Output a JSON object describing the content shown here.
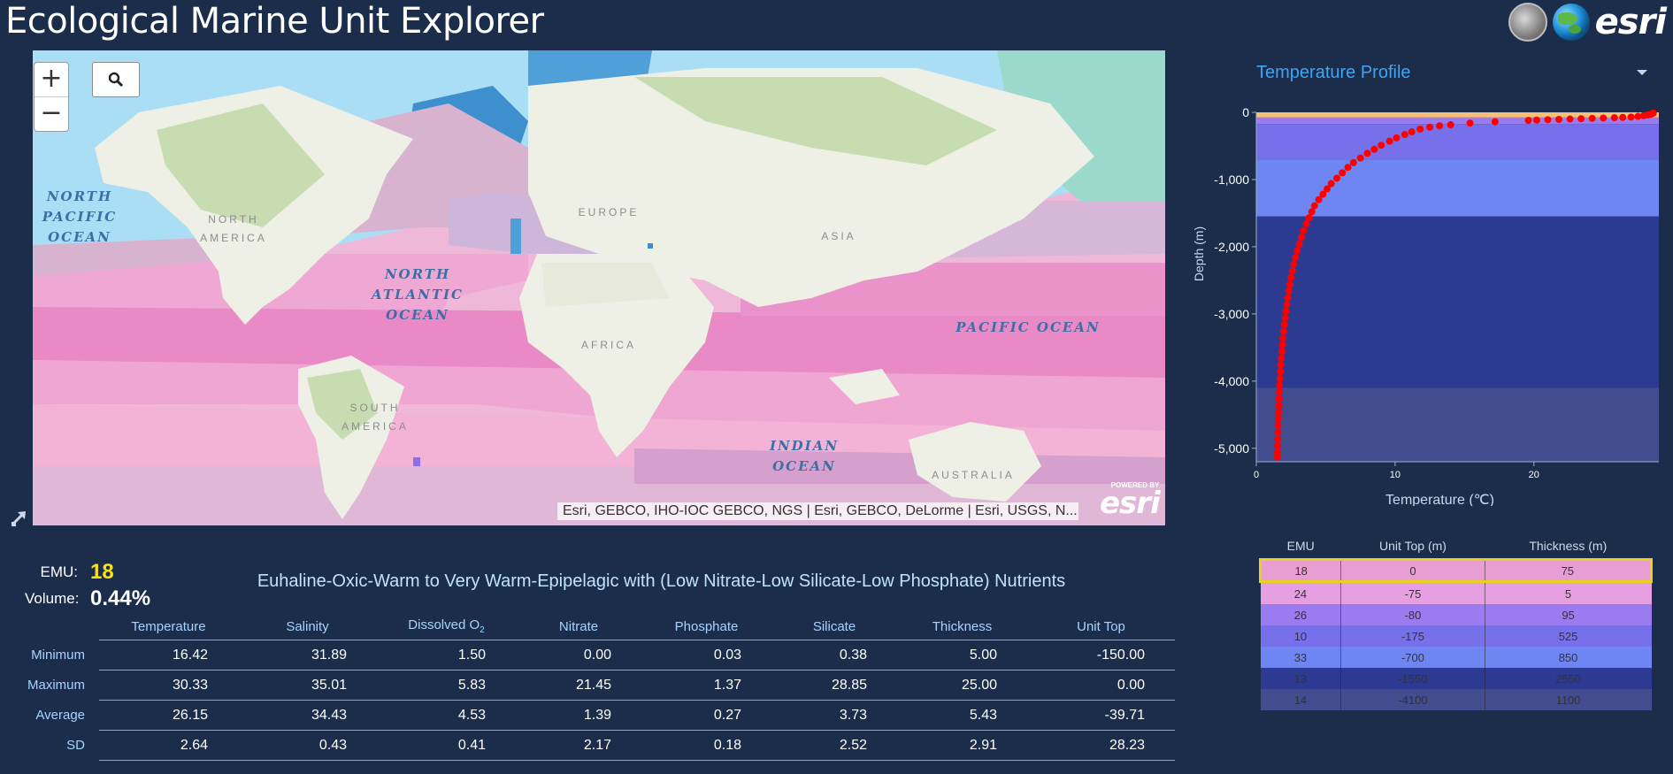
{
  "header": {
    "title": "Ecological Marine Unit Explorer",
    "brand": "esri"
  },
  "map": {
    "zoom_in": "+",
    "zoom_out": "−",
    "attribution": "Esri, GEBCO, IHO-IOC GEBCO, NGS | Esri, GEBCO, DeLorme | Esri, USGS, N...",
    "powered_by": "POWERED BY",
    "esri_logo": "esri",
    "ocean_labels": {
      "north_pacific": [
        "NORTH",
        "PACIFIC",
        "OCEAN"
      ],
      "north_atlantic": [
        "NORTH",
        "ATLANTIC",
        "OCEAN"
      ],
      "pacific": "PACIFIC OCEAN",
      "indian": [
        "INDIAN",
        "OCEAN"
      ]
    },
    "land_labels": {
      "north_america": [
        "NORTH",
        "AMERICA"
      ],
      "europe": "EUROPE",
      "asia": "ASIA",
      "africa": "AFRICA",
      "south_america": [
        "SOUTH",
        "AMERICA"
      ],
      "australia": "AUSTRALIA",
      "south_partial": "SOUTH"
    },
    "colors": {
      "ocean_warm": "#e98ac6",
      "ocean_pink": "#f2b3d6",
      "ocean_mauve": "#d8b3cf",
      "ocean_lavender": "#cdb6da",
      "ocean_light_blue": "#a9def5",
      "ocean_teal": "#9ad9cc",
      "ocean_blue": "#4f9fd8",
      "land": "#eef0e6",
      "land_green": "#c7dcb1"
    }
  },
  "chart_panel": {
    "selector_value": "Temperature Profile",
    "chart_data": {
      "type": "scatter",
      "xlabel": "Temperature (℃)",
      "ylabel": "Depth (m)",
      "xlim": [
        0,
        29
      ],
      "ylim": [
        -5200,
        0
      ],
      "x_ticks": [
        "0",
        "10",
        "20"
      ],
      "x_tick_values": [
        0,
        10,
        20
      ],
      "y_ticks": [
        "0",
        "-1,000",
        "-2,000",
        "-3,000",
        "-4,000",
        "-5,000"
      ],
      "y_tick_values": [
        0,
        -1000,
        -2000,
        -3000,
        -4000,
        -5000
      ],
      "grid": false,
      "point_color": "#ff0000",
      "layers": [
        {
          "top": 0,
          "bottom": -75,
          "color": "#f6c078"
        },
        {
          "top": -75,
          "bottom": -80,
          "color": "#e99ed3"
        },
        {
          "top": -80,
          "bottom": -175,
          "color": "#9a7bf0"
        },
        {
          "top": -175,
          "bottom": -700,
          "color": "#7670ea"
        },
        {
          "top": -700,
          "bottom": -1550,
          "color": "#6f85f2"
        },
        {
          "top": -1550,
          "bottom": -4100,
          "color": "#2c3b91"
        },
        {
          "top": -4100,
          "bottom": -5200,
          "color": "#434c8e"
        }
      ],
      "points": [
        [
          28.6,
          -10
        ],
        [
          28.5,
          -20
        ],
        [
          28.4,
          -30
        ],
        [
          28.2,
          -40
        ],
        [
          27.9,
          -50
        ],
        [
          27.5,
          -60
        ],
        [
          27.0,
          -70
        ],
        [
          26.4,
          -75
        ],
        [
          25.8,
          -80
        ],
        [
          25.0,
          -85
        ],
        [
          24.2,
          -90
        ],
        [
          23.4,
          -95
        ],
        [
          22.6,
          -100
        ],
        [
          21.8,
          -105
        ],
        [
          21.0,
          -110
        ],
        [
          20.2,
          -115
        ],
        [
          19.6,
          -120
        ],
        [
          17.2,
          -140
        ],
        [
          15.4,
          -160
        ],
        [
          14.0,
          -185
        ],
        [
          13.2,
          -200
        ],
        [
          12.5,
          -220
        ],
        [
          11.8,
          -250
        ],
        [
          11.2,
          -290
        ],
        [
          10.7,
          -330
        ],
        [
          10.1,
          -380
        ],
        [
          9.6,
          -430
        ],
        [
          9.0,
          -490
        ],
        [
          8.5,
          -550
        ],
        [
          8.0,
          -610
        ],
        [
          7.5,
          -680
        ],
        [
          7.0,
          -750
        ],
        [
          6.6,
          -820
        ],
        [
          6.2,
          -900
        ],
        [
          5.8,
          -980
        ],
        [
          5.4,
          -1060
        ],
        [
          5.1,
          -1140
        ],
        [
          4.8,
          -1220
        ],
        [
          4.5,
          -1300
        ],
        [
          4.2,
          -1390
        ],
        [
          4.0,
          -1480
        ],
        [
          3.8,
          -1570
        ],
        [
          3.6,
          -1660
        ],
        [
          3.4,
          -1760
        ],
        [
          3.25,
          -1860
        ],
        [
          3.1,
          -1960
        ],
        [
          2.95,
          -2060
        ],
        [
          2.82,
          -2160
        ],
        [
          2.7,
          -2260
        ],
        [
          2.6,
          -2360
        ],
        [
          2.5,
          -2460
        ],
        [
          2.42,
          -2560
        ],
        [
          2.34,
          -2660
        ],
        [
          2.27,
          -2760
        ],
        [
          2.2,
          -2860
        ],
        [
          2.14,
          -2960
        ],
        [
          2.08,
          -3060
        ],
        [
          2.02,
          -3160
        ],
        [
          1.97,
          -3260
        ],
        [
          1.92,
          -3360
        ],
        [
          1.88,
          -3460
        ],
        [
          1.84,
          -3560
        ],
        [
          1.8,
          -3660
        ],
        [
          1.77,
          -3760
        ],
        [
          1.74,
          -3860
        ],
        [
          1.71,
          -3960
        ],
        [
          1.68,
          -4060
        ],
        [
          1.66,
          -4160
        ],
        [
          1.64,
          -4260
        ],
        [
          1.62,
          -4360
        ],
        [
          1.6,
          -4460
        ],
        [
          1.58,
          -4560
        ],
        [
          1.57,
          -4660
        ],
        [
          1.56,
          -4760
        ],
        [
          1.55,
          -4860
        ],
        [
          1.54,
          -4960
        ],
        [
          1.53,
          -5060
        ],
        [
          1.52,
          -5130
        ]
      ]
    }
  },
  "emu_table": {
    "headers": [
      "EMU",
      "Unit Top (m)",
      "Thickness (m)"
    ],
    "rows": [
      {
        "emu": "18",
        "top": "0",
        "thickness": "75",
        "color": "#e99ed3",
        "selected": true
      },
      {
        "emu": "24",
        "top": "-75",
        "thickness": "5",
        "color": "#e6a0e2"
      },
      {
        "emu": "26",
        "top": "-80",
        "thickness": "95",
        "color": "#9a7bf0"
      },
      {
        "emu": "10",
        "top": "-175",
        "thickness": "525",
        "color": "#7670ea"
      },
      {
        "emu": "33",
        "top": "-700",
        "thickness": "850",
        "color": "#6f85f2"
      },
      {
        "emu": "13",
        "top": "-1550",
        "thickness": "2550",
        "color": "#2c3b91"
      },
      {
        "emu": "14",
        "top": "-4100",
        "thickness": "1100",
        "color": "#434c8e"
      }
    ]
  },
  "emu_summary": {
    "emu_label": "EMU:",
    "emu_value": "18",
    "volume_label": "Volume:",
    "volume_value": "0.44%",
    "description": "Euhaline-Oxic-Warm to Very Warm-Epipelagic with (Low Nitrate-Low Silicate-Low Phosphate) Nutrients"
  },
  "stats": {
    "columns": [
      "Temperature",
      "Salinity",
      "Dissolved O",
      "Nitrate",
      "Phosphate",
      "Silicate",
      "Thickness",
      "Unit Top"
    ],
    "o2_subscript": "2",
    "rows": [
      {
        "label": "Minimum",
        "values": [
          "16.42",
          "31.89",
          "1.50",
          "0.00",
          "0.03",
          "0.38",
          "5.00",
          "-150.00"
        ]
      },
      {
        "label": "Maximum",
        "values": [
          "30.33",
          "35.01",
          "5.83",
          "21.45",
          "1.37",
          "28.85",
          "25.00",
          "0.00"
        ]
      },
      {
        "label": "Average",
        "values": [
          "26.15",
          "34.43",
          "4.53",
          "1.39",
          "0.27",
          "3.73",
          "5.43",
          "-39.71"
        ]
      },
      {
        "label": "SD",
        "values": [
          "2.64",
          "0.43",
          "0.41",
          "2.17",
          "0.18",
          "2.52",
          "2.91",
          "28.23"
        ]
      }
    ]
  }
}
